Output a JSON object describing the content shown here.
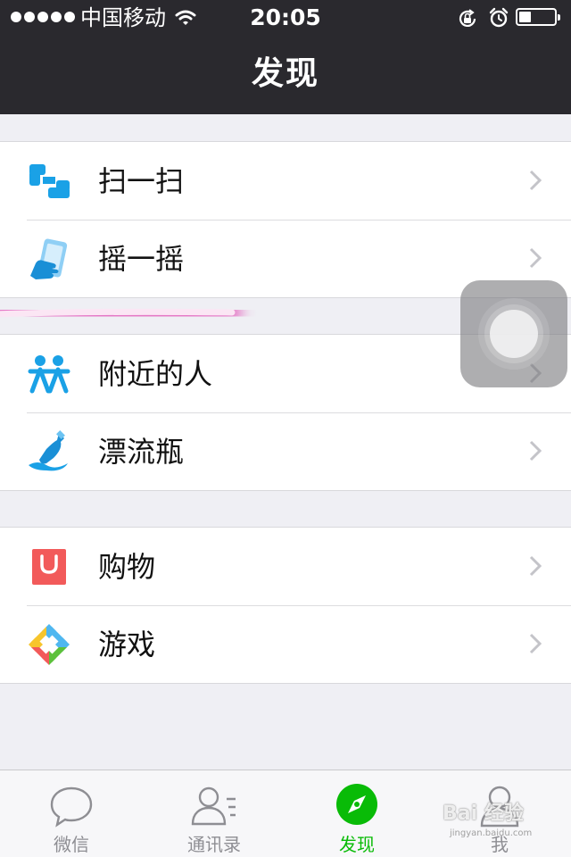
{
  "status_bar": {
    "carrier": "中国移动",
    "time": "20:05",
    "icons": [
      "signal-dots-icon",
      "wifi-icon",
      "rotation-lock-icon",
      "alarm-icon",
      "battery-icon"
    ],
    "battery_level": 0.35
  },
  "nav": {
    "title": "发现"
  },
  "groups": [
    {
      "items": [
        {
          "label": "扫一扫",
          "icon": "scan-icon"
        },
        {
          "label": "摇一摇",
          "icon": "shake-phone-icon"
        }
      ]
    },
    {
      "items": [
        {
          "label": "附近的人",
          "icon": "people-nearby-icon"
        },
        {
          "label": "漂流瓶",
          "icon": "drift-bottle-icon"
        }
      ]
    },
    {
      "items": [
        {
          "label": "购物",
          "icon": "shopping-bag-icon"
        },
        {
          "label": "游戏",
          "icon": "games-icon"
        }
      ]
    }
  ],
  "tabs": [
    {
      "label": "微信",
      "icon": "chat-bubble-icon",
      "active": false
    },
    {
      "label": "通讯录",
      "icon": "contacts-icon",
      "active": false
    },
    {
      "label": "发现",
      "icon": "compass-icon",
      "active": true
    },
    {
      "label": "我",
      "icon": "profile-icon",
      "active": false
    }
  ],
  "watermark": {
    "main": "Bai 经验",
    "sub": "jingyan.baidu.com"
  },
  "colors": {
    "nav_bg": "#2a292e",
    "page_bg": "#efeff4",
    "accent_green": "#09bb07",
    "icon_blue": "#1aa1e6",
    "shopping_red": "#f25a5a",
    "highlight_pink": "#e040b0"
  }
}
